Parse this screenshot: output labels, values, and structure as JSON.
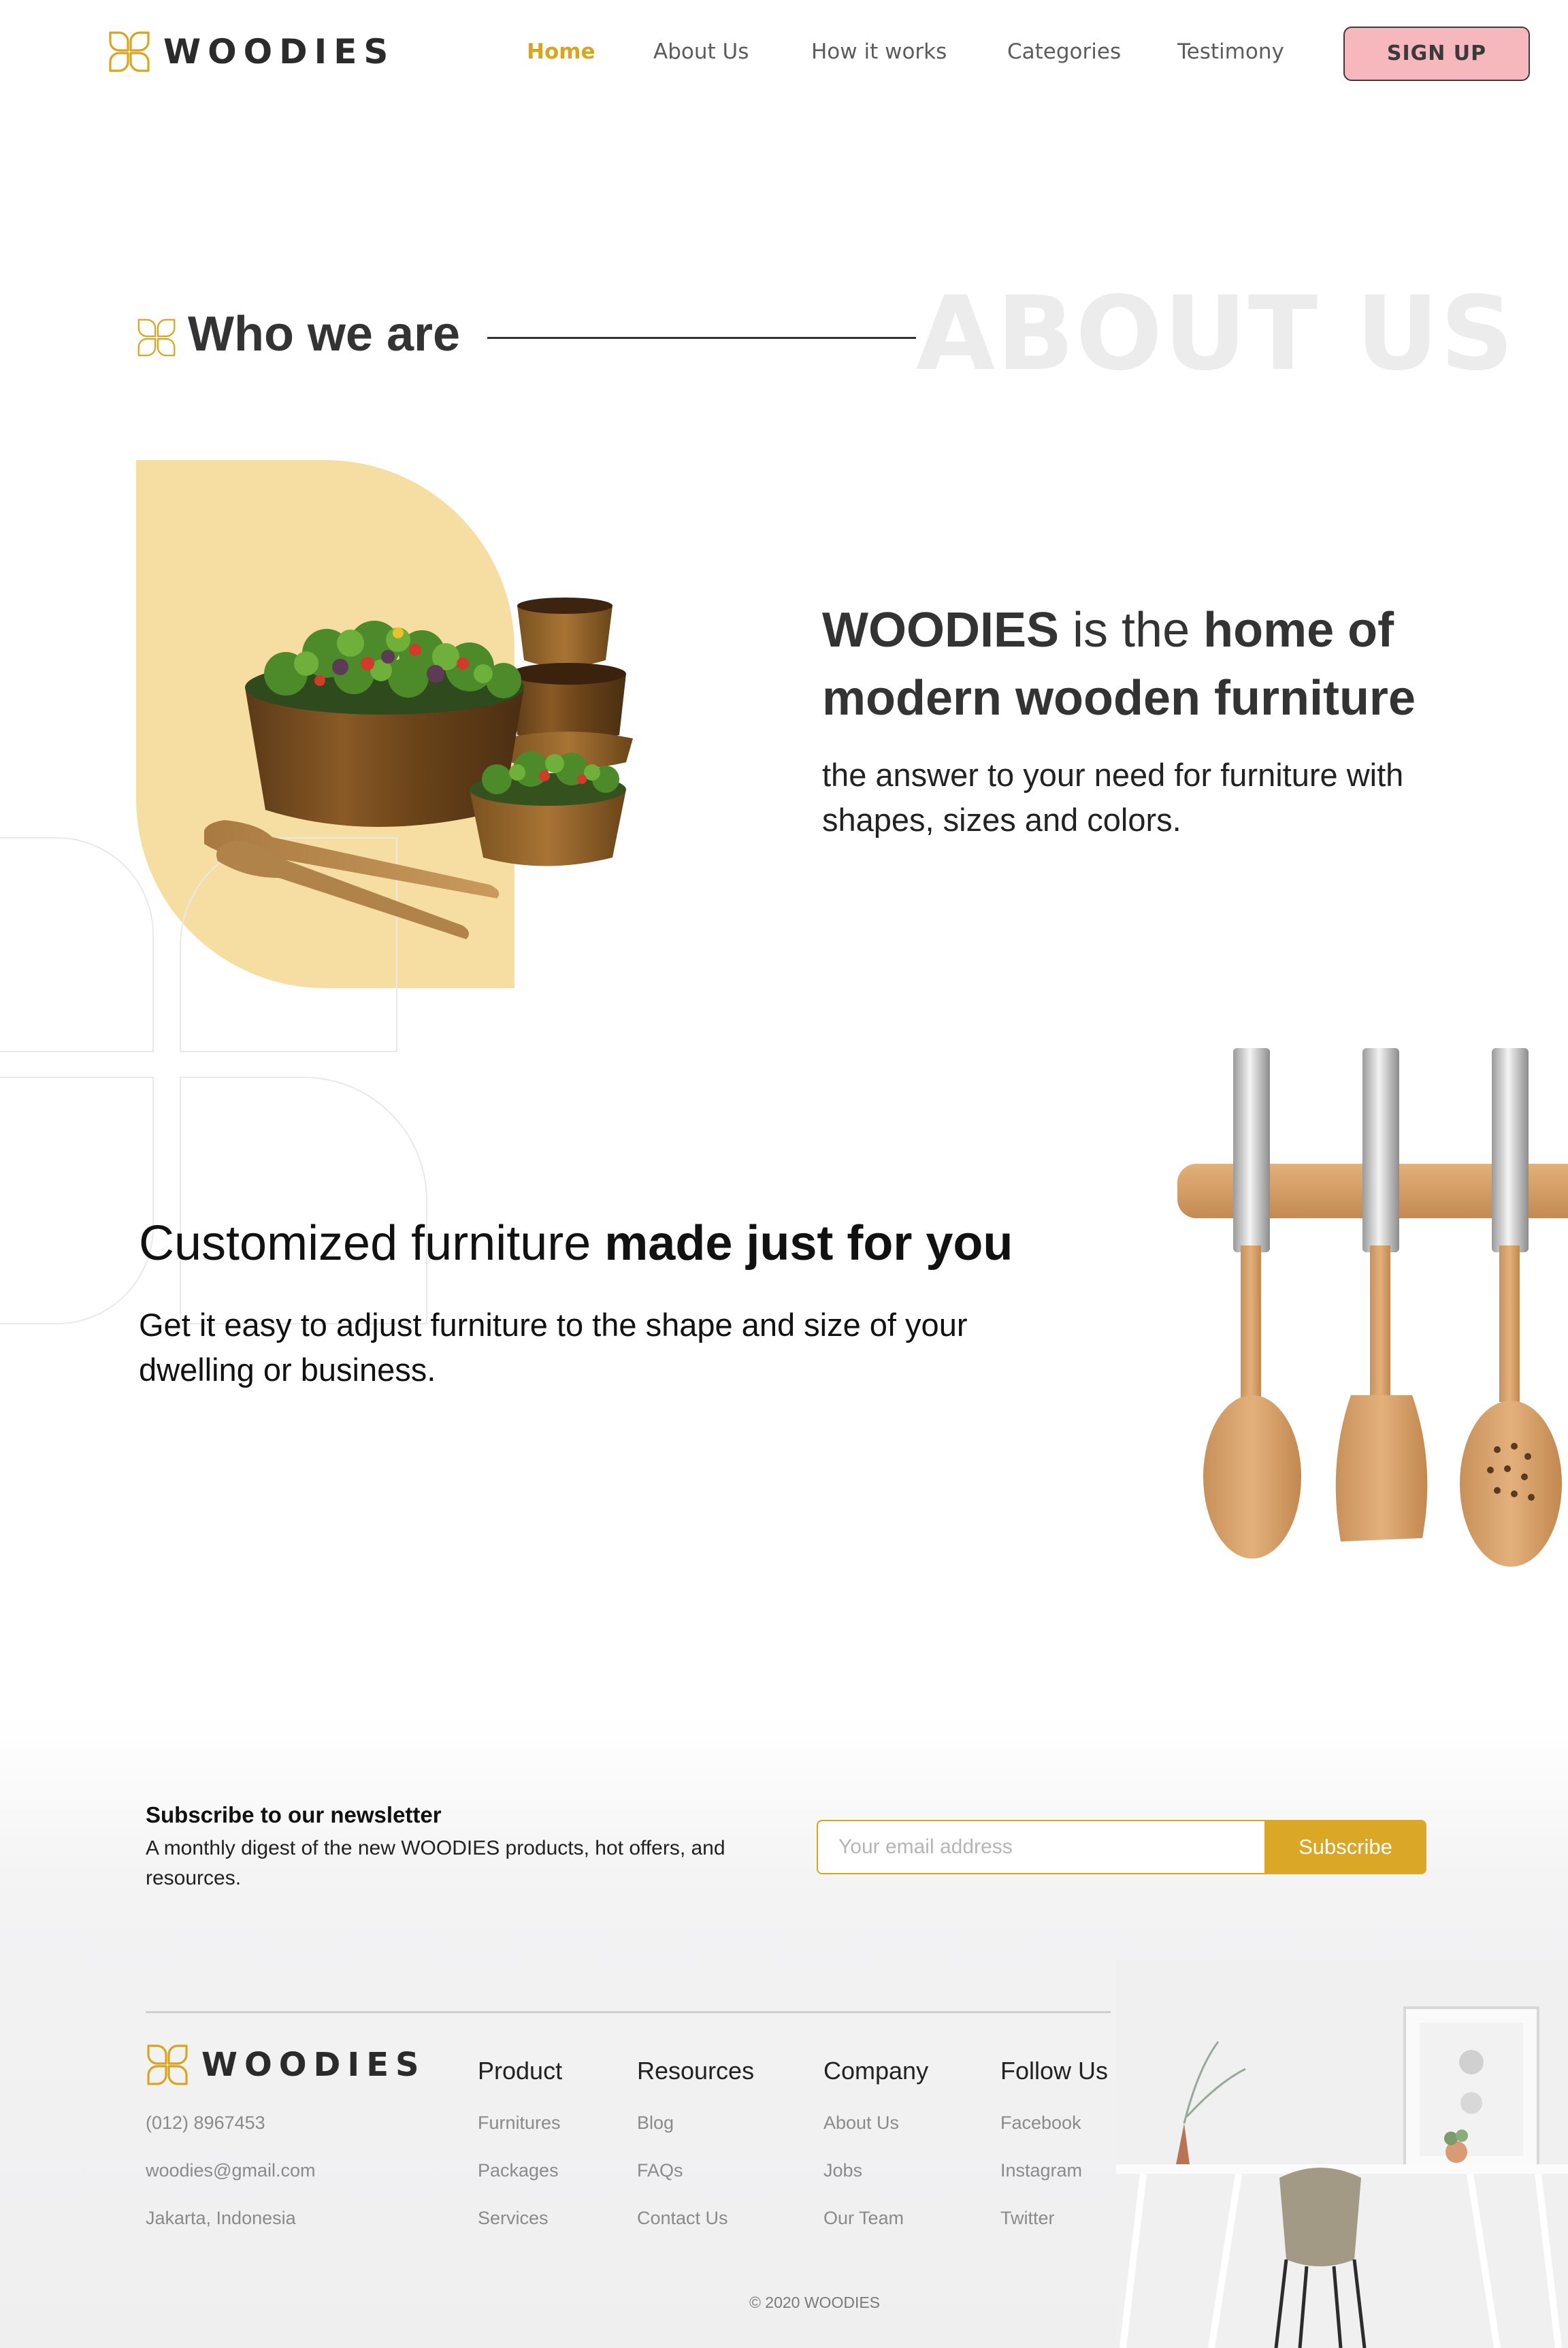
{
  "brand": {
    "name": "WOODIES"
  },
  "nav": {
    "links": [
      "Home",
      "About Us",
      "How it works",
      "Categories",
      "Testimony"
    ],
    "active": "Home",
    "signup_label": "SIGN UP"
  },
  "about": {
    "heading": "Who we are",
    "background_text": "ABOUT US",
    "title_brand": "WOODIES",
    "title_middle": " is the ",
    "title_bold": "home of modern wooden furniture",
    "subtitle": "the answer to your need for furniture with shapes, sizes and colors."
  },
  "custom": {
    "title_regular": "Customized furniture ",
    "title_bold": "made just for you",
    "subtitle": "Get it easy to adjust furniture to the shape and size of your dwelling or business."
  },
  "newsletter": {
    "title": "Subscribe to our newsletter",
    "description": "A monthly digest of the new WOODIES products, hot offers, and resources.",
    "placeholder": "Your email address",
    "button_label": "Subscribe"
  },
  "footer": {
    "contact": [
      "(012) 8967453",
      "woodies@gmail.com",
      "Jakarta, Indonesia"
    ],
    "columns": [
      {
        "title": "Product",
        "links": [
          "Furnitures",
          "Packages",
          "Services"
        ]
      },
      {
        "title": "Resources",
        "links": [
          "Blog",
          "FAQs",
          "Contact Us"
        ]
      },
      {
        "title": "Company",
        "links": [
          "About Us",
          "Jobs",
          "Our Team"
        ]
      },
      {
        "title": "Follow Us",
        "links": [
          "Facebook",
          "Instagram",
          "Twitter"
        ]
      }
    ],
    "copyright": "© 2020 WOODIES"
  },
  "colors": {
    "accent": "#d8a521",
    "accent_button": "#dba726",
    "signup_bg": "#f6b8bd",
    "shape_yellow": "#f6dea2",
    "text_dark": "#333333",
    "watermark": "#ececec"
  },
  "icons": [
    "logo-flower-icon"
  ]
}
